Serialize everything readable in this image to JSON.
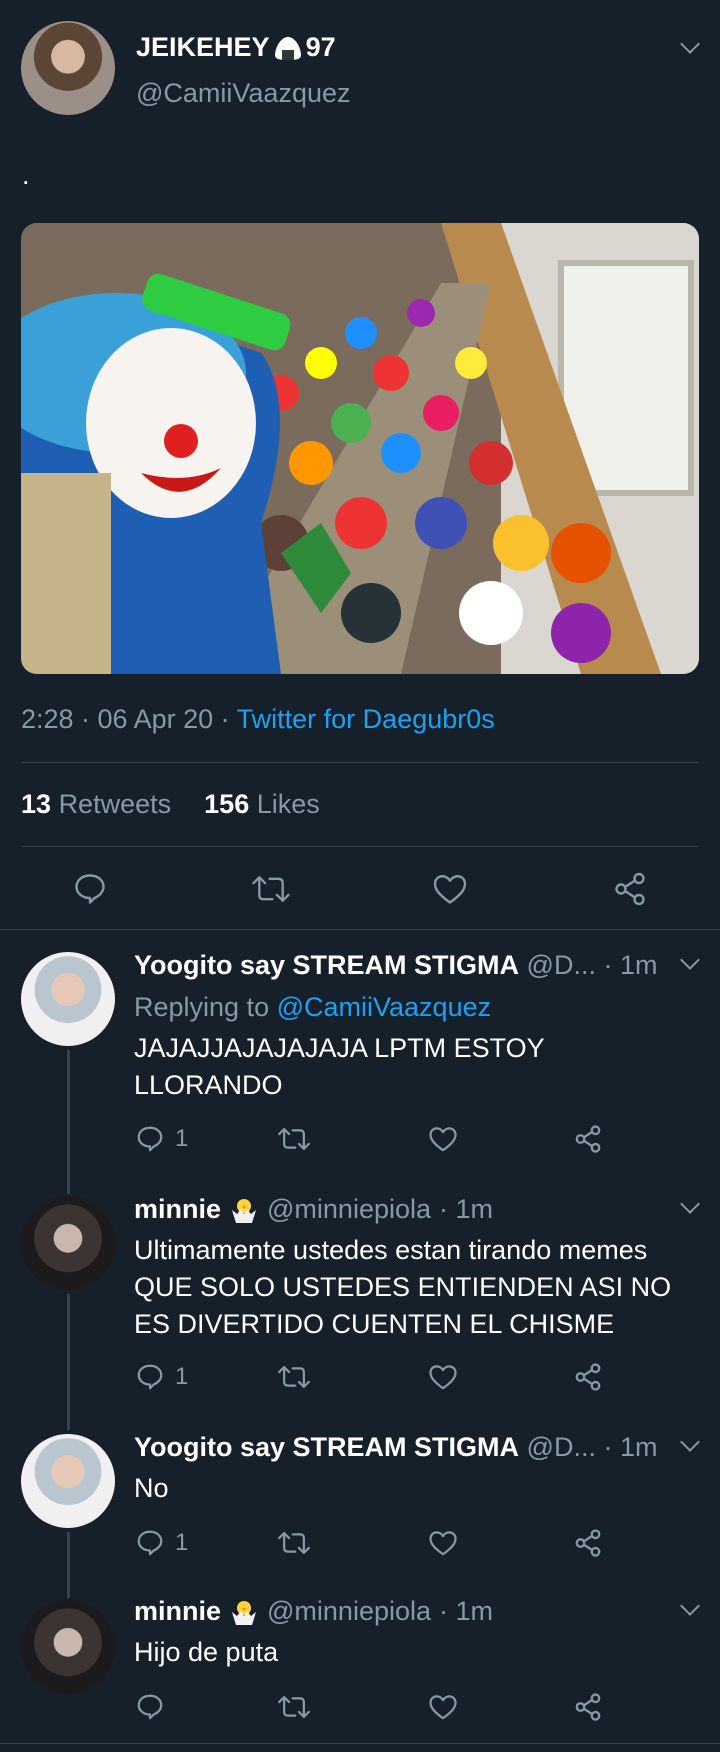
{
  "tweet": {
    "display_name": "JEIKEHEY",
    "name_suffix": "97",
    "handle": "@CamiiVaazquez",
    "text": ".",
    "time": "2:28 · 06 Apr 20 ·",
    "source": "Twitter for Daegubr0s",
    "retweets_count": "13",
    "retweets_label": "Retweets",
    "likes_count": "156",
    "likes_label": "Likes"
  },
  "replies": [
    {
      "name": "Yoogito say STREAM STIGMA",
      "handle": "@D...",
      "time": "· 1m",
      "replying_prefix": "Replying to",
      "replying_handle": "@CamiiVaazquez",
      "text": "JAJAJJAJAJAJAJA LPTM ESTOY LLORANDO",
      "reply_count": "1"
    },
    {
      "name": "minnie",
      "handle": "@minniepiola",
      "time": "· 1m",
      "text": "Ultimamente ustedes estan tirando memes QUE SOLO USTEDES ENTIENDEN ASI NO ES DIVERTIDO CUENTEN EL CHISME",
      "reply_count": "1"
    },
    {
      "name": "Yoogito say STREAM STIGMA",
      "handle": "@D...",
      "time": "· 1m",
      "text": "No",
      "reply_count": "1"
    },
    {
      "name": "minnie",
      "handle": "@minniepiola",
      "time": "· 1m",
      "text": "Hijo de puta",
      "reply_count": ""
    }
  ],
  "colors": {
    "background": "#15202b",
    "link": "#1da1f2",
    "muted": "#8899a6",
    "divider": "#38444d"
  },
  "icons": [
    "chevron-down-icon",
    "rice-ball-icon",
    "chick-icon",
    "reply-icon",
    "retweet-icon",
    "like-icon",
    "share-icon"
  ]
}
